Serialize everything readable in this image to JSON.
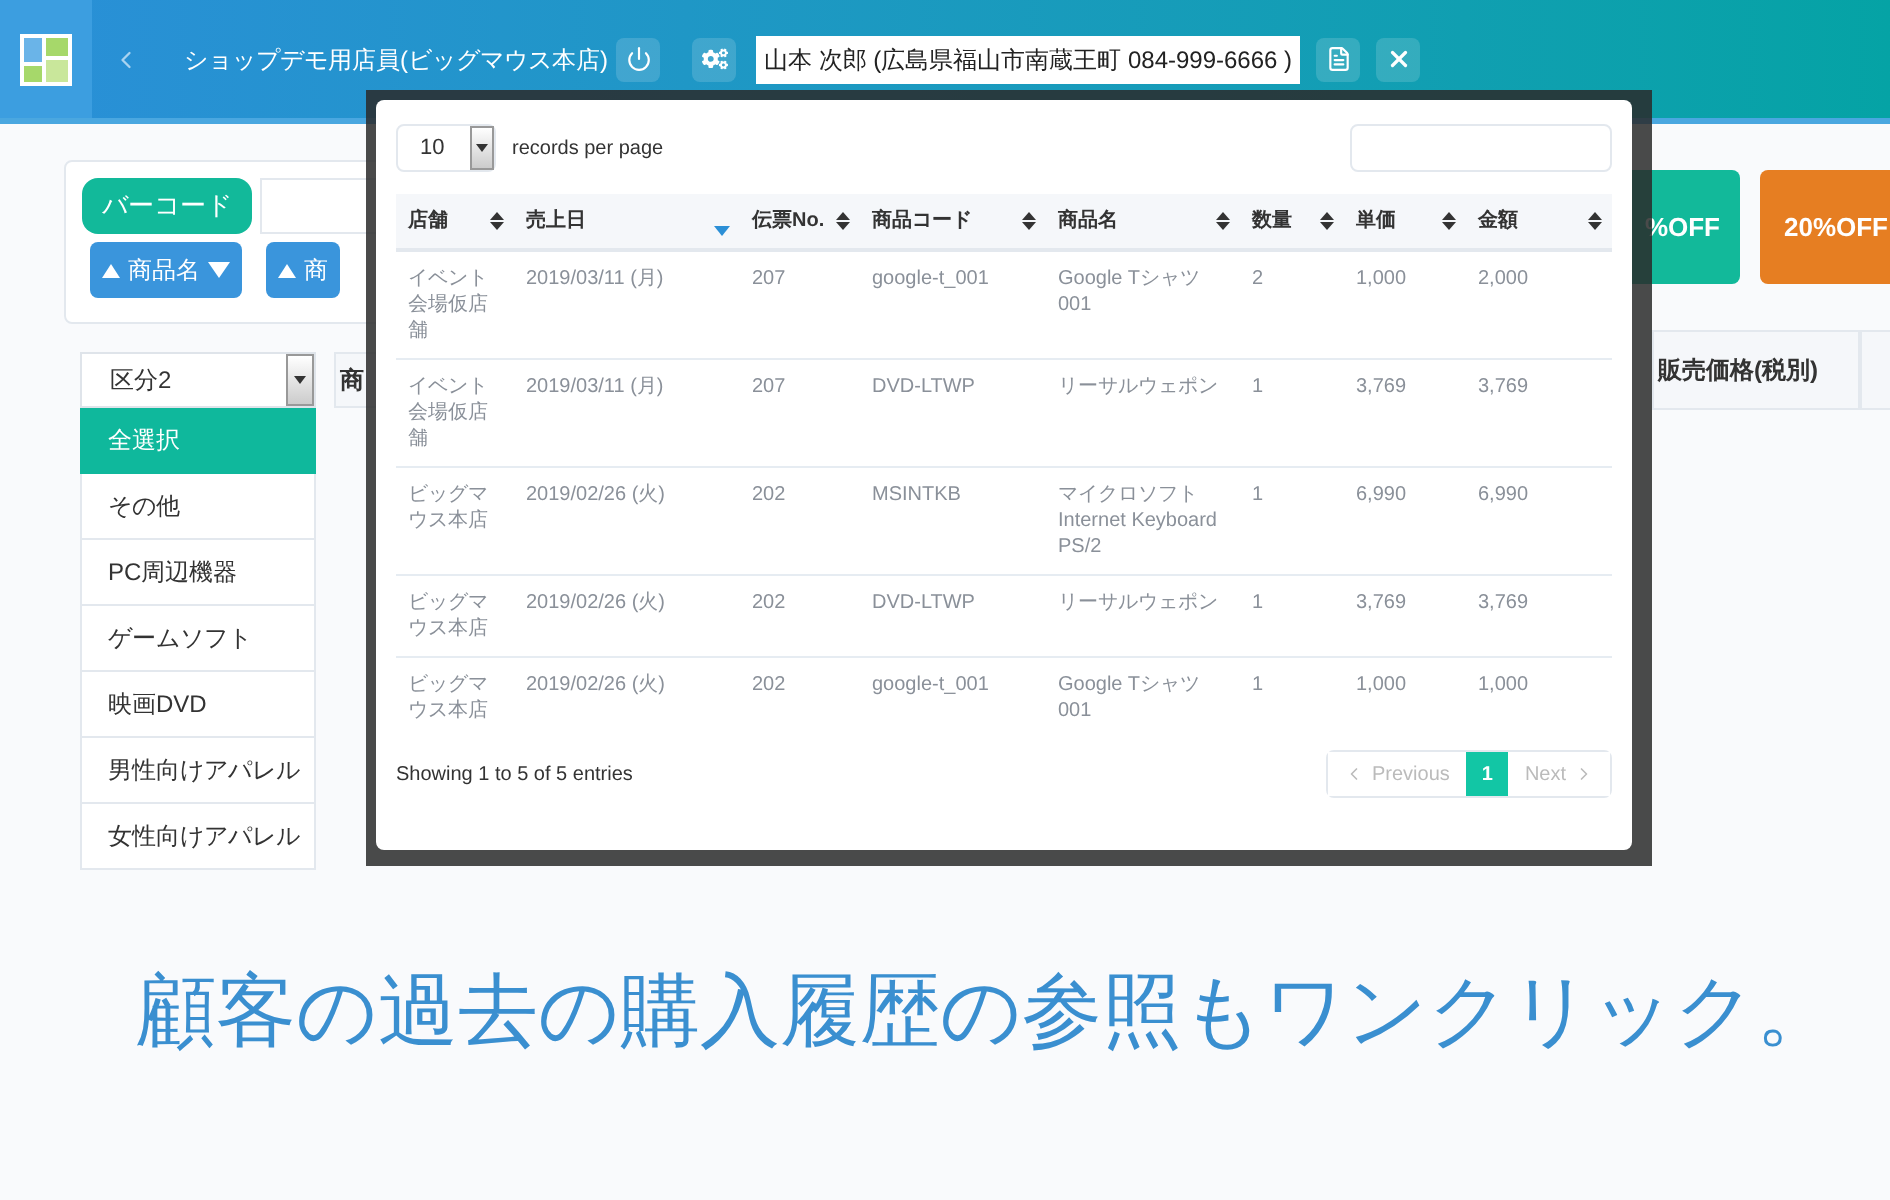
{
  "header": {
    "user": "ショップデモ用店員(ビッグマウス本店)",
    "customer": "山本 次郎 (広島県福山市南蔵王町 084-999-6666 )"
  },
  "barcode_panel": {
    "button": "バーコード",
    "sort_buttons": [
      {
        "label": "商品名",
        "arrow_down": true
      },
      {
        "label": "商",
        "arrow_down": false
      }
    ]
  },
  "discount_buttons": [
    {
      "label": "%OFF",
      "color": "#12b99a"
    },
    {
      "label": "20%OFF",
      "color": "#e67e22"
    }
  ],
  "category_select": {
    "value": "区分2",
    "items": [
      {
        "label": "全選択",
        "selected": true
      },
      {
        "label": "その他",
        "selected": false
      },
      {
        "label": "PC周辺機器",
        "selected": false
      },
      {
        "label": "ゲームソフト",
        "selected": false
      },
      {
        "label": "映画DVD",
        "selected": false
      },
      {
        "label": "男性向けアパレル",
        "selected": false
      },
      {
        "label": "女性向けアパレル",
        "selected": false
      }
    ]
  },
  "background_table": {
    "columns": [
      "商",
      "販売価格(税別)"
    ]
  },
  "modal": {
    "page_size": "10",
    "page_size_label": "records per page",
    "columns": [
      {
        "label": "店舗",
        "sorted_desc": false
      },
      {
        "label": "売上日",
        "sorted_desc": true
      },
      {
        "label": "伝票No.",
        "sorted_desc": false
      },
      {
        "label": "商品コード",
        "sorted_desc": false
      },
      {
        "label": "商品名",
        "sorted_desc": false
      },
      {
        "label": "数量",
        "sorted_desc": false
      },
      {
        "label": "単価",
        "sorted_desc": false
      },
      {
        "label": "金額",
        "sorted_desc": false
      }
    ],
    "rows": [
      [
        "イベント会場仮店舗",
        "2019/03/11 (月)",
        "207",
        "google-t_001",
        "Google Tシャツ001",
        "2",
        "1,000",
        "2,000"
      ],
      [
        "イベント会場仮店舗",
        "2019/03/11 (月)",
        "207",
        "DVD-LTWP",
        "リーサルウェポン",
        "1",
        "3,769",
        "3,769"
      ],
      [
        "ビッグマウス本店",
        "2019/02/26 (火)",
        "202",
        "MSINTKB",
        "マイクロソフト Internet Keyboard PS/2",
        "1",
        "6,990",
        "6,990"
      ],
      [
        "ビッグマウス本店",
        "2019/02/26 (火)",
        "202",
        "DVD-LTWP",
        "リーサルウェポン",
        "1",
        "3,769",
        "3,769"
      ],
      [
        "ビッグマウス本店",
        "2019/02/26 (火)",
        "202",
        "google-t_001",
        "Google Tシャツ001",
        "1",
        "1,000",
        "1,000"
      ]
    ],
    "info": "Showing 1 to 5 of 5 entries",
    "pagination": [
      {
        "kind": "prev",
        "label": "Previous",
        "selected": false,
        "disabled": true
      },
      {
        "kind": "page",
        "label": "1",
        "selected": true,
        "disabled": false
      },
      {
        "kind": "next",
        "label": "Next",
        "selected": false,
        "disabled": true
      }
    ]
  },
  "caption": "顧客の過去の購入履歴の参照もワンクリック。"
}
